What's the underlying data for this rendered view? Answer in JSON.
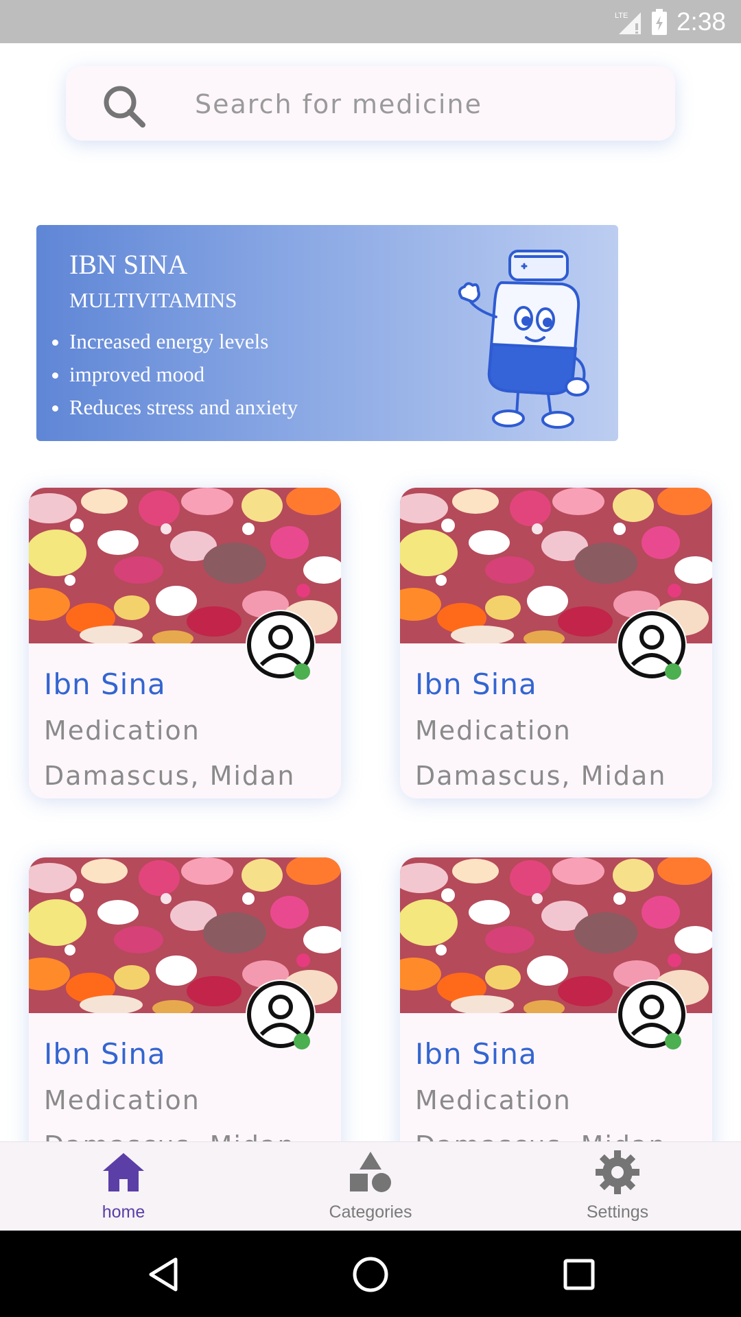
{
  "status_bar": {
    "network": "LTE",
    "time": "2:38"
  },
  "search": {
    "placeholder": "Search for medicine",
    "value": ""
  },
  "banner": {
    "title": "IBN SINA",
    "subtitle": "MULTIVITAMINS",
    "points": [
      "Increased energy levels",
      "improved mood",
      "Reduces stress and anxiety"
    ]
  },
  "cards": [
    {
      "name": "Ibn Sina",
      "type": "Medication",
      "location": "Damascus, Midan",
      "online": true
    },
    {
      "name": "Ibn Sina",
      "type": "Medication",
      "location": "Damascus, Midan",
      "online": true
    },
    {
      "name": "Ibn Sina",
      "type": "Medication",
      "location": "Damascus, Midan",
      "online": true
    },
    {
      "name": "Ibn Sina",
      "type": "Medication",
      "location": "Damascus, Midan",
      "online": true
    }
  ],
  "bottom_nav": {
    "items": [
      {
        "label": "home",
        "icon": "home-icon",
        "active": true
      },
      {
        "label": "Categories",
        "icon": "categories-icon",
        "active": false
      },
      {
        "label": "Settings",
        "icon": "gear-icon",
        "active": false
      }
    ]
  },
  "colors": {
    "accent": "#5b3fa6",
    "card_title": "#3465d0",
    "online": "#4caf50",
    "banner_start": "#5f86d6",
    "banner_end": "#bccdf1"
  }
}
